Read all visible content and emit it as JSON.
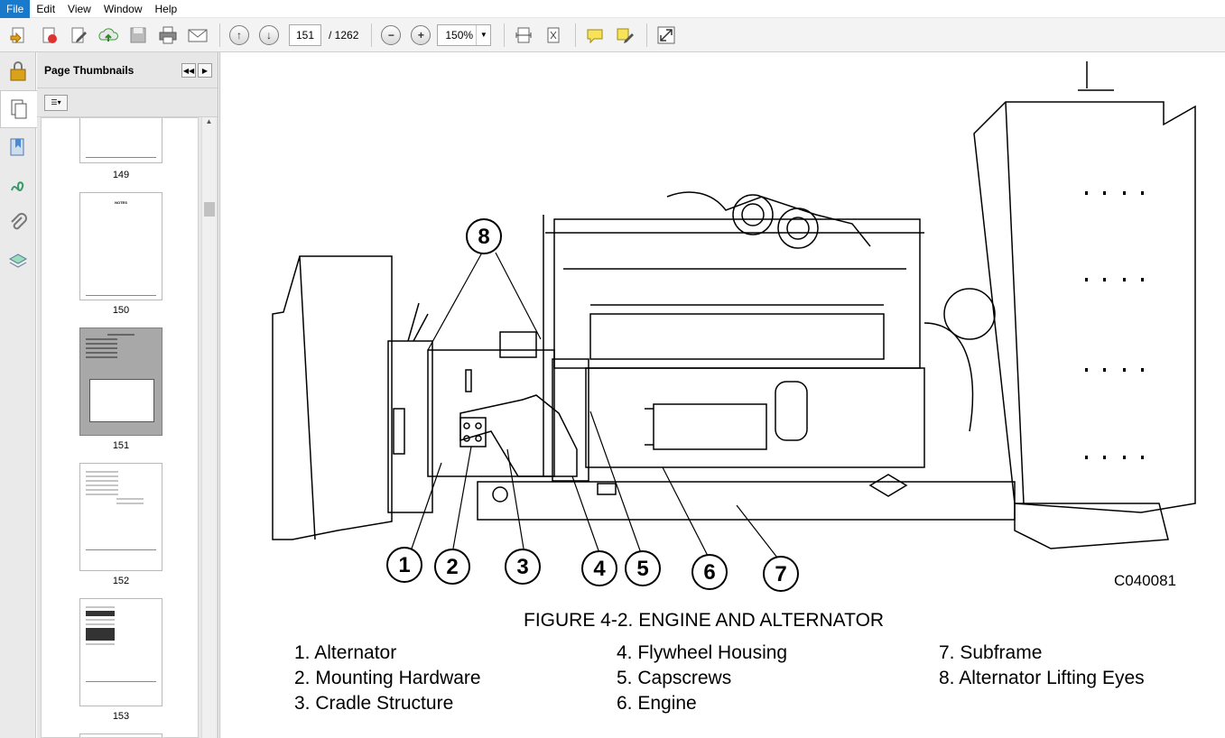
{
  "menu": {
    "items": [
      "File",
      "Edit",
      "View",
      "Window",
      "Help"
    ]
  },
  "toolbar": {
    "page_current": "151",
    "page_total": "/ 1262",
    "zoom": "150%",
    "icons": [
      "create-icon",
      "export-icon",
      "edit-icon",
      "upload-icon",
      "save-icon",
      "print-icon",
      "email-icon",
      "page-up-icon",
      "page-down-icon",
      "zoom-out-icon",
      "zoom-in-icon",
      "fit-page-icon",
      "rotate-icon",
      "comment-icon",
      "highlight-icon",
      "fullscreen-icon"
    ]
  },
  "rail": {
    "icons": [
      "lock-icon",
      "page-thumbnails-icon",
      "bookmark-icon",
      "signature-icon",
      "attachment-icon",
      "layers-icon"
    ]
  },
  "panel": {
    "title": "Page Thumbnails",
    "thumbnails": [
      {
        "label": "149"
      },
      {
        "label": "150"
      },
      {
        "label": "151"
      },
      {
        "label": "152"
      },
      {
        "label": "153"
      }
    ]
  },
  "document": {
    "figure_code": "C040081",
    "caption": "FIGURE 4-2. ENGINE AND ALTERNATOR",
    "callouts": [
      "8",
      "1",
      "2",
      "3",
      "4",
      "5",
      "6",
      "7"
    ],
    "legend_col1": [
      "1. Alternator",
      "2. Mounting Hardware",
      "3. Cradle Structure"
    ],
    "legend_col2": [
      "4. Flywheel Housing",
      "5. Capscrews",
      "6. Engine"
    ],
    "legend_col3": [
      "7. Subframe",
      "8. Alternator Lifting Eyes"
    ]
  }
}
